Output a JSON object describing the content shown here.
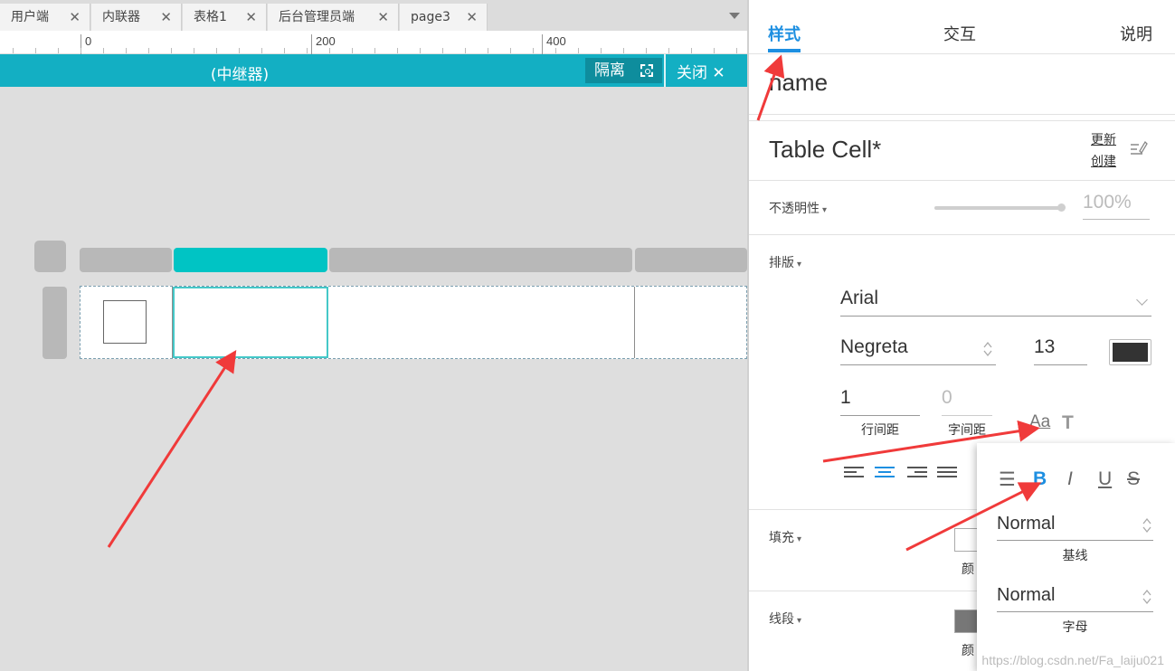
{
  "tabs": [
    {
      "label": "用户端",
      "close": "✕"
    },
    {
      "label": "内联器",
      "close": "✕"
    },
    {
      "label": "表格1",
      "close": "✕"
    },
    {
      "label": "后台管理员端",
      "close": "✕"
    },
    {
      "label": "page3",
      "close": "✕"
    }
  ],
  "ruler": {
    "labels": [
      "0",
      "200",
      "400"
    ]
  },
  "repeater_bar": {
    "title": "(中继器)",
    "isolate_label": "隔离",
    "close_label": "关闭 ✕"
  },
  "inspector": {
    "tabs": [
      "样式",
      "交互",
      "说明"
    ],
    "name_field": "name",
    "style_name": "Table Cell*",
    "update_link": "更新",
    "create_link": "创建",
    "opacity": {
      "label": "不透明性",
      "caret": "▾",
      "value": "100%"
    },
    "typography": {
      "label": "排版",
      "caret": "▾",
      "font_family": "Arial",
      "font_weight": "Negreta",
      "font_size": "13",
      "font_color": "#333333",
      "line_spacing": "1",
      "line_spacing_label": "行间距",
      "char_spacing": "0",
      "char_spacing_label": "字间距"
    },
    "fill": {
      "label": "填充",
      "caret": "▾",
      "peek": "颜"
    },
    "line": {
      "label": "线段",
      "caret": "▾",
      "peek": "颜"
    },
    "text_popup": {
      "icons": [
        "☰",
        "B",
        "I",
        "U",
        "S"
      ],
      "baseline_value": "Normal",
      "baseline_label": "基线",
      "case_value": "Normal",
      "case_label": "字母"
    }
  },
  "watermark": "https://blog.csdn.net/Fa_laiju021",
  "colors": {
    "accent": "#1d8fe1",
    "repeater_bar": "#13afc3",
    "active_column": "#00c4c4",
    "annotation_arrow": "#f03a3a"
  }
}
